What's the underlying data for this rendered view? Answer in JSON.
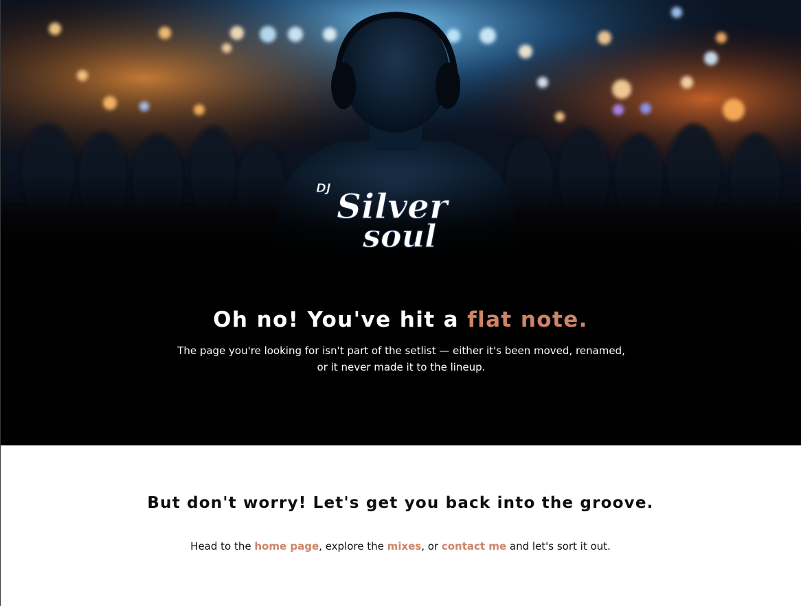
{
  "logo": {
    "small": "DJ",
    "line1": "Silver",
    "line2": "soul"
  },
  "hero": {
    "title_prefix": "Oh no! You've hit a ",
    "title_accent": "flat note.",
    "subtitle": "The page you're looking for isn't part of the setlist — either it's been moved, renamed, or it never made it to the lineup."
  },
  "content": {
    "heading": "But don't worry! Let's get you back into the groove.",
    "text_1": "Head to the ",
    "link_home": "home page",
    "text_2": ", explore the ",
    "link_mixes": "mixes",
    "text_3": ", or ",
    "link_contact": "contact me",
    "text_4": " and let's sort it out."
  },
  "colors": {
    "accent": "#cd8467",
    "hero_bg": "#000000",
    "page_bg": "#ffffff"
  }
}
